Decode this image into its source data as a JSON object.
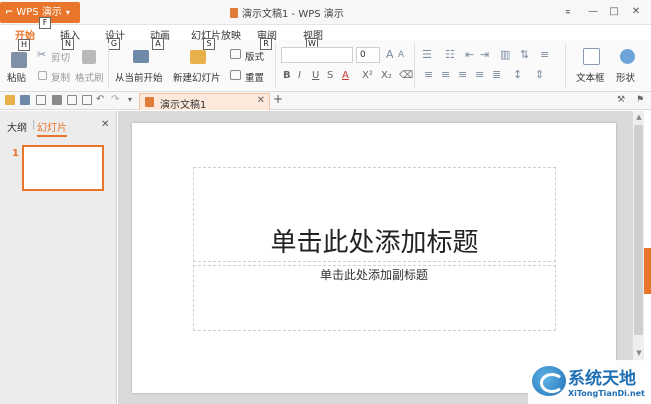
{
  "titlebar": {
    "app_menu": "WPS 演示",
    "doc_title": "演示文稿1 - WPS 演示"
  },
  "tabs": [
    {
      "label": "开始",
      "key": "H"
    },
    {
      "label": "插入",
      "key": "N"
    },
    {
      "label": "设计",
      "key": "G"
    },
    {
      "label": "动画",
      "key": "A"
    },
    {
      "label": "幻灯片放映",
      "key": "S"
    },
    {
      "label": "审阅",
      "key": "R"
    },
    {
      "label": "视图",
      "key": "W"
    }
  ],
  "app_key": "F",
  "ribbon": {
    "paste": "粘贴",
    "cut": "剪切",
    "copy": "复制",
    "format_painter": "格式刷",
    "from_current": "从当前开始",
    "new_slide": "新建幻灯片",
    "layout": "版式",
    "reset": "重置",
    "font_size": "0",
    "textbox": "文本框",
    "shape": "形状"
  },
  "document_tab": "演示文稿1",
  "left_pane": {
    "outline_tab": "大纲",
    "slides_tab": "幻灯片",
    "slide_number": "1"
  },
  "slide": {
    "title_placeholder": "单击此处添加标题",
    "subtitle_placeholder": "单击此处添加副标题"
  },
  "watermark": {
    "title": "系统天地",
    "url": "XiTongTianDi.net"
  },
  "colors": {
    "accent": "#e8752a",
    "watermark": "#1f6fb5"
  }
}
